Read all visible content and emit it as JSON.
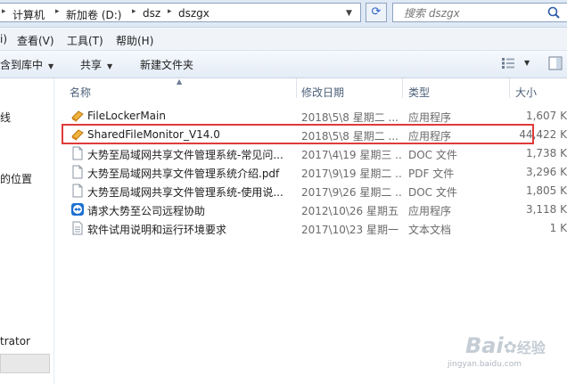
{
  "address": {
    "crumbs": [
      "计算机",
      "新加卷 (D:)",
      "dsz",
      "dszgx"
    ]
  },
  "search": {
    "placeholder": "搜索 dszgx"
  },
  "menu": [
    "查看(V)",
    "工具(T)",
    "帮助(H)"
  ],
  "menu_partial": "i)",
  "toolbar": {
    "include_library": "含到库中",
    "share": "共享",
    "new_folder": "新建文件夹"
  },
  "nav": {
    "items": [
      "线",
      "的位置",
      "trator"
    ]
  },
  "columns": {
    "name": "名称",
    "date": "修改日期",
    "type": "类型",
    "size": "大小"
  },
  "files": [
    {
      "name": "FileLockerMain",
      "date": "2018\\5\\8 星期二 ...",
      "type": "应用程序",
      "size": "1,607 K",
      "icon": "app-icon"
    },
    {
      "name": "SharedFileMonitor_V14.0",
      "date": "2018\\5\\8 星期二 ...",
      "type": "应用程序",
      "size": "44,422 K",
      "icon": "app-icon"
    },
    {
      "name": "大势至局域网共享文件管理系统-常见问...",
      "date": "2017\\4\\19 星期三 ...",
      "type": "DOC 文件",
      "size": "1,738 K",
      "icon": "doc-icon"
    },
    {
      "name": "大势至局域网共享文件管理系统介绍.pdf",
      "date": "2017\\9\\19 星期二 ...",
      "type": "PDF 文件",
      "size": "3,296 K",
      "icon": "doc-icon"
    },
    {
      "name": "大势至局域网共享文件管理系统-使用说...",
      "date": "2017\\9\\26 星期二 ...",
      "type": "DOC 文件",
      "size": "1,805 K",
      "icon": "doc-icon"
    },
    {
      "name": "请求大势至公司远程协助",
      "date": "2012\\10\\26 星期五 ...",
      "type": "应用程序",
      "size": "3,118 K",
      "icon": "teamviewer-icon"
    },
    {
      "name": "软件试用说明和运行环境要求",
      "date": "2017\\10\\23 星期一 ...",
      "type": "文本文档",
      "size": "1 K",
      "icon": "text-file-icon"
    }
  ],
  "watermark": {
    "text": "Bai",
    "suffix": "经验",
    "url": "jingyan.baidu.com"
  }
}
